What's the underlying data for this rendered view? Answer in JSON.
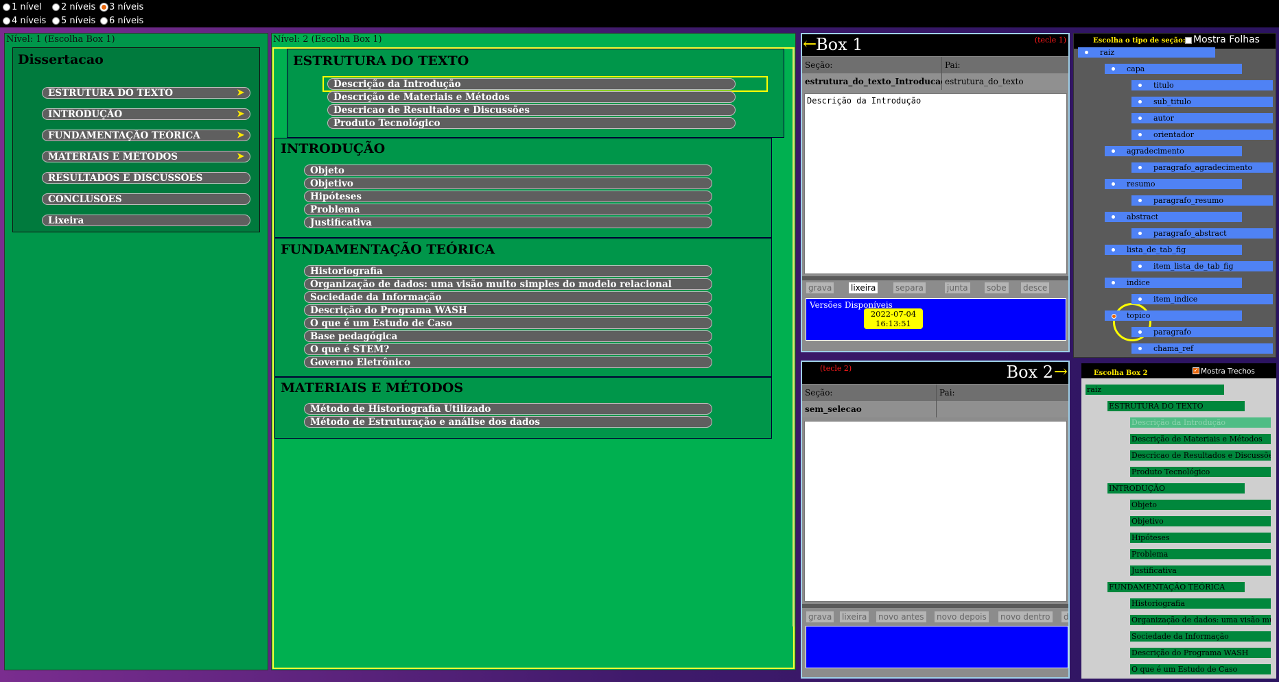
{
  "levels": [
    {
      "label": "1 nível",
      "checked": false
    },
    {
      "label": "2 níveis",
      "checked": false
    },
    {
      "label": "3 níveis",
      "checked": true
    },
    {
      "label": "4 níveis",
      "checked": false
    },
    {
      "label": "5 níveis",
      "checked": false
    },
    {
      "label": "6 níveis",
      "checked": false
    }
  ],
  "level1": {
    "header": "Nível: 1 (Escolha Box 1)",
    "title": "Dissertacao",
    "items": [
      {
        "label": "ESTRUTURA DO TEXTO",
        "arrow": "➤"
      },
      {
        "label": "INTRODUÇÃO",
        "arrow": "➤"
      },
      {
        "label": "FUNDAMENTAÇÃO TEÓRICA",
        "arrow": "➤"
      },
      {
        "label": "MATERIAIS E MÉTODOS",
        "arrow": "➤"
      },
      {
        "label": "RESULTADOS E DISCUSSÕES"
      },
      {
        "label": "CONCLUSÕES"
      },
      {
        "label": "Lixeira"
      }
    ]
  },
  "level2": {
    "header": "Nível: 2 (Escolha Box 1)",
    "sections": [
      {
        "title": "ESTRUTURA DO TEXTO",
        "items": [
          "Descrição da Introdução",
          "Descrição de Materiais e Métodos",
          "Descricao de Resultados e Discussões",
          "Produto Tecnológico"
        ]
      },
      {
        "title": "INTRODUÇÃO",
        "items": [
          "Objeto",
          "Objetivo",
          "Hipóteses",
          "Problema",
          "Justificativa"
        ]
      },
      {
        "title": "FUNDAMENTAÇÃO TEÓRICA",
        "items": [
          "Historiografia",
          "Organização de dados: uma visão muito simples do modelo relacional",
          "Sociedade da Informação",
          "Descrição do Programa WASH",
          "O que é um Estudo de Caso",
          "Base pedagógica",
          "O que é STEM?",
          "Governo Eletrônico"
        ]
      },
      {
        "title": "MATERIAIS E MÉTODOS",
        "items": [
          "Método de Historiografia Utilizado",
          "Método de Estruturação e análise dos dados"
        ]
      }
    ]
  },
  "box1": {
    "title": "Box 1",
    "arrow": "←",
    "hint": "(tecle 1)",
    "secao_label": "Seção:",
    "pai_label": "Pai:",
    "secao_value": "estrutura_do_texto_Introducao",
    "pai_value": "estrutura_do_texto",
    "text": "Descrição da Introdução",
    "buttons": [
      "grava",
      "lixeira",
      "separa",
      "junta",
      "sobe",
      "desce"
    ],
    "active_button": "lixeira",
    "versions_label": "Versões Disponíveis",
    "version_date": "2022-07-04",
    "version_time": "16:13:51"
  },
  "box2": {
    "title": "Box 2",
    "arrow": "→",
    "hint": "(tecle 2)",
    "secao_label": "Seção:",
    "pai_label": "Pai:",
    "secao_value": "sem_selecao",
    "pai_value": "",
    "text": "",
    "buttons": [
      "grava",
      "lixeira",
      "novo antes",
      "novo depois",
      "novo dentro",
      "de"
    ]
  },
  "sectionType": {
    "label": "Escolha o tipo de seção:",
    "show_leaves": "Mostra Folhas",
    "nodes": [
      {
        "label": "raiz",
        "depth": 0
      },
      {
        "label": "capa",
        "depth": 1
      },
      {
        "label": "titulo",
        "depth": 2
      },
      {
        "label": "sub_titulo",
        "depth": 2
      },
      {
        "label": "autor",
        "depth": 2
      },
      {
        "label": "orientador",
        "depth": 2
      },
      {
        "label": "agradecimento",
        "depth": 1
      },
      {
        "label": "paragrafo_agradecimento",
        "depth": 2
      },
      {
        "label": "resumo",
        "depth": 1
      },
      {
        "label": "paragrafo_resumo",
        "depth": 2
      },
      {
        "label": "abstract",
        "depth": 1
      },
      {
        "label": "paragrafo_abstract",
        "depth": 2
      },
      {
        "label": "lista_de_tab_fig",
        "depth": 1
      },
      {
        "label": "item_lista_de_tab_fig",
        "depth": 2
      },
      {
        "label": "indice",
        "depth": 1
      },
      {
        "label": "item_indice",
        "depth": 2
      },
      {
        "label": "topico",
        "depth": 1
      },
      {
        "label": "paragrafo",
        "depth": 2
      },
      {
        "label": "chama_ref",
        "depth": 2
      }
    ]
  },
  "box2Tree": {
    "label": "Escolha Box 2",
    "show_excerpts": "Mostra Trechos",
    "nodes": [
      {
        "label": "raiz",
        "depth": 0
      },
      {
        "label": "ESTRUTURA DO TEXTO",
        "depth": 1
      },
      {
        "label": "Descrição da Introdução",
        "depth": 2,
        "dim": true
      },
      {
        "label": "Descrição de Materiais e Métodos",
        "depth": 2
      },
      {
        "label": "Descricao de Resultados e Discussões",
        "depth": 2
      },
      {
        "label": "Produto Tecnológico",
        "depth": 2
      },
      {
        "label": "INTRODUÇÃO",
        "depth": 1
      },
      {
        "label": "Objeto",
        "depth": 2
      },
      {
        "label": "Objetivo",
        "depth": 2
      },
      {
        "label": "Hipóteses",
        "depth": 2
      },
      {
        "label": "Problema",
        "depth": 2
      },
      {
        "label": "Justificativa",
        "depth": 2
      },
      {
        "label": "FUNDAMENTAÇÃO TEÓRICA",
        "depth": 1
      },
      {
        "label": "Historiografia",
        "depth": 2
      },
      {
        "label": "Organização de dados: uma visão muito simples do modelo relacional",
        "depth": 2
      },
      {
        "label": "Sociedade da Informação",
        "depth": 2
      },
      {
        "label": "Descrição do Programa WASH",
        "depth": 2
      },
      {
        "label": "O que é um Estudo de Caso",
        "depth": 2
      }
    ]
  }
}
